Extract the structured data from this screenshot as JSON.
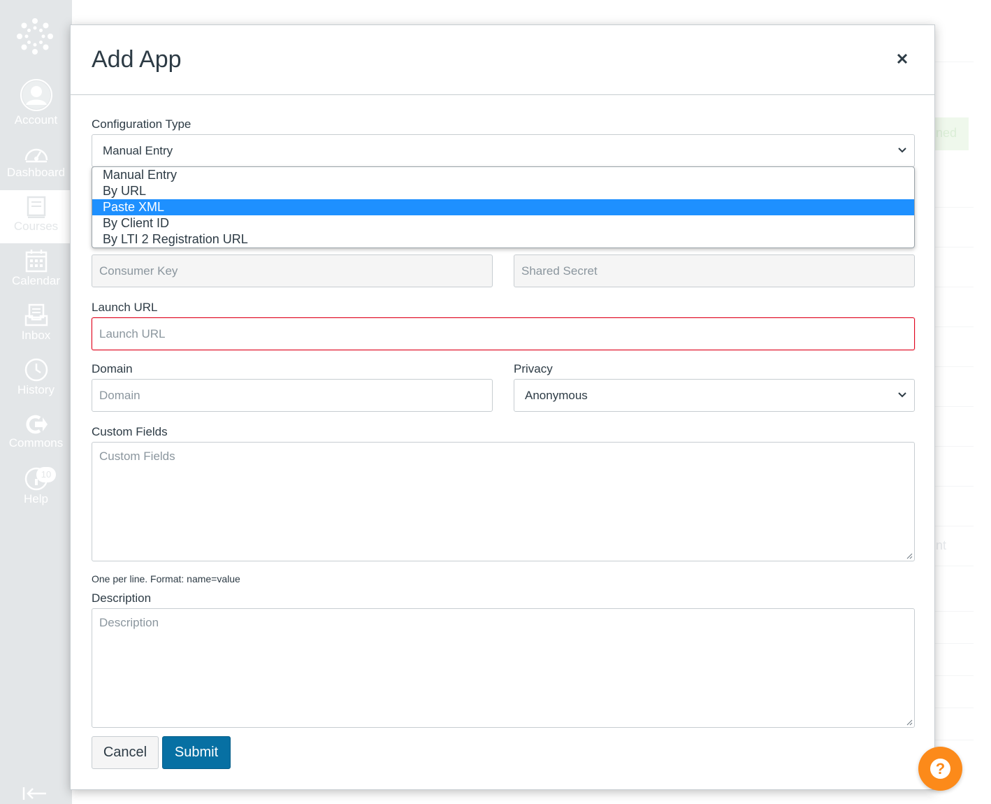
{
  "nav": {
    "items": [
      {
        "label": "Account",
        "icon": "account-icon"
      },
      {
        "label": "Dashboard",
        "icon": "dashboard-icon"
      },
      {
        "label": "Courses",
        "icon": "courses-icon"
      },
      {
        "label": "Calendar",
        "icon": "calendar-icon"
      },
      {
        "label": "Inbox",
        "icon": "inbox-icon"
      },
      {
        "label": "History",
        "icon": "history-icon"
      },
      {
        "label": "Commons",
        "icon": "commons-icon"
      },
      {
        "label": "Help",
        "icon": "help-icon",
        "badge": "10"
      }
    ]
  },
  "background": {
    "partial_1": "ned",
    "partial_2": "nt"
  },
  "modal": {
    "title": "Add App",
    "config_type": {
      "label": "Configuration Type",
      "value": "Manual Entry",
      "options": [
        "Manual Entry",
        "By URL",
        "Paste XML",
        "By Client ID",
        "By LTI 2 Registration URL"
      ],
      "highlighted": "Paste XML"
    },
    "consumer_key": {
      "placeholder": "Consumer Key"
    },
    "shared_secret": {
      "placeholder": "Shared Secret"
    },
    "launch_url": {
      "label": "Launch URL",
      "placeholder": "Launch URL"
    },
    "domain": {
      "label": "Domain",
      "placeholder": "Domain"
    },
    "privacy": {
      "label": "Privacy",
      "value": "Anonymous"
    },
    "custom_fields": {
      "label": "Custom Fields",
      "placeholder": "Custom Fields",
      "hint": "One per line. Format: name=value"
    },
    "description": {
      "label": "Description",
      "placeholder": "Description"
    },
    "cancel_label": "Cancel",
    "submit_label": "Submit"
  },
  "colors": {
    "nav_bg": "#c7cdd1",
    "primary": "#0770a3",
    "highlight": "#1e90ff",
    "error": "#e0061f",
    "help_fab": "#fc8a1a"
  }
}
